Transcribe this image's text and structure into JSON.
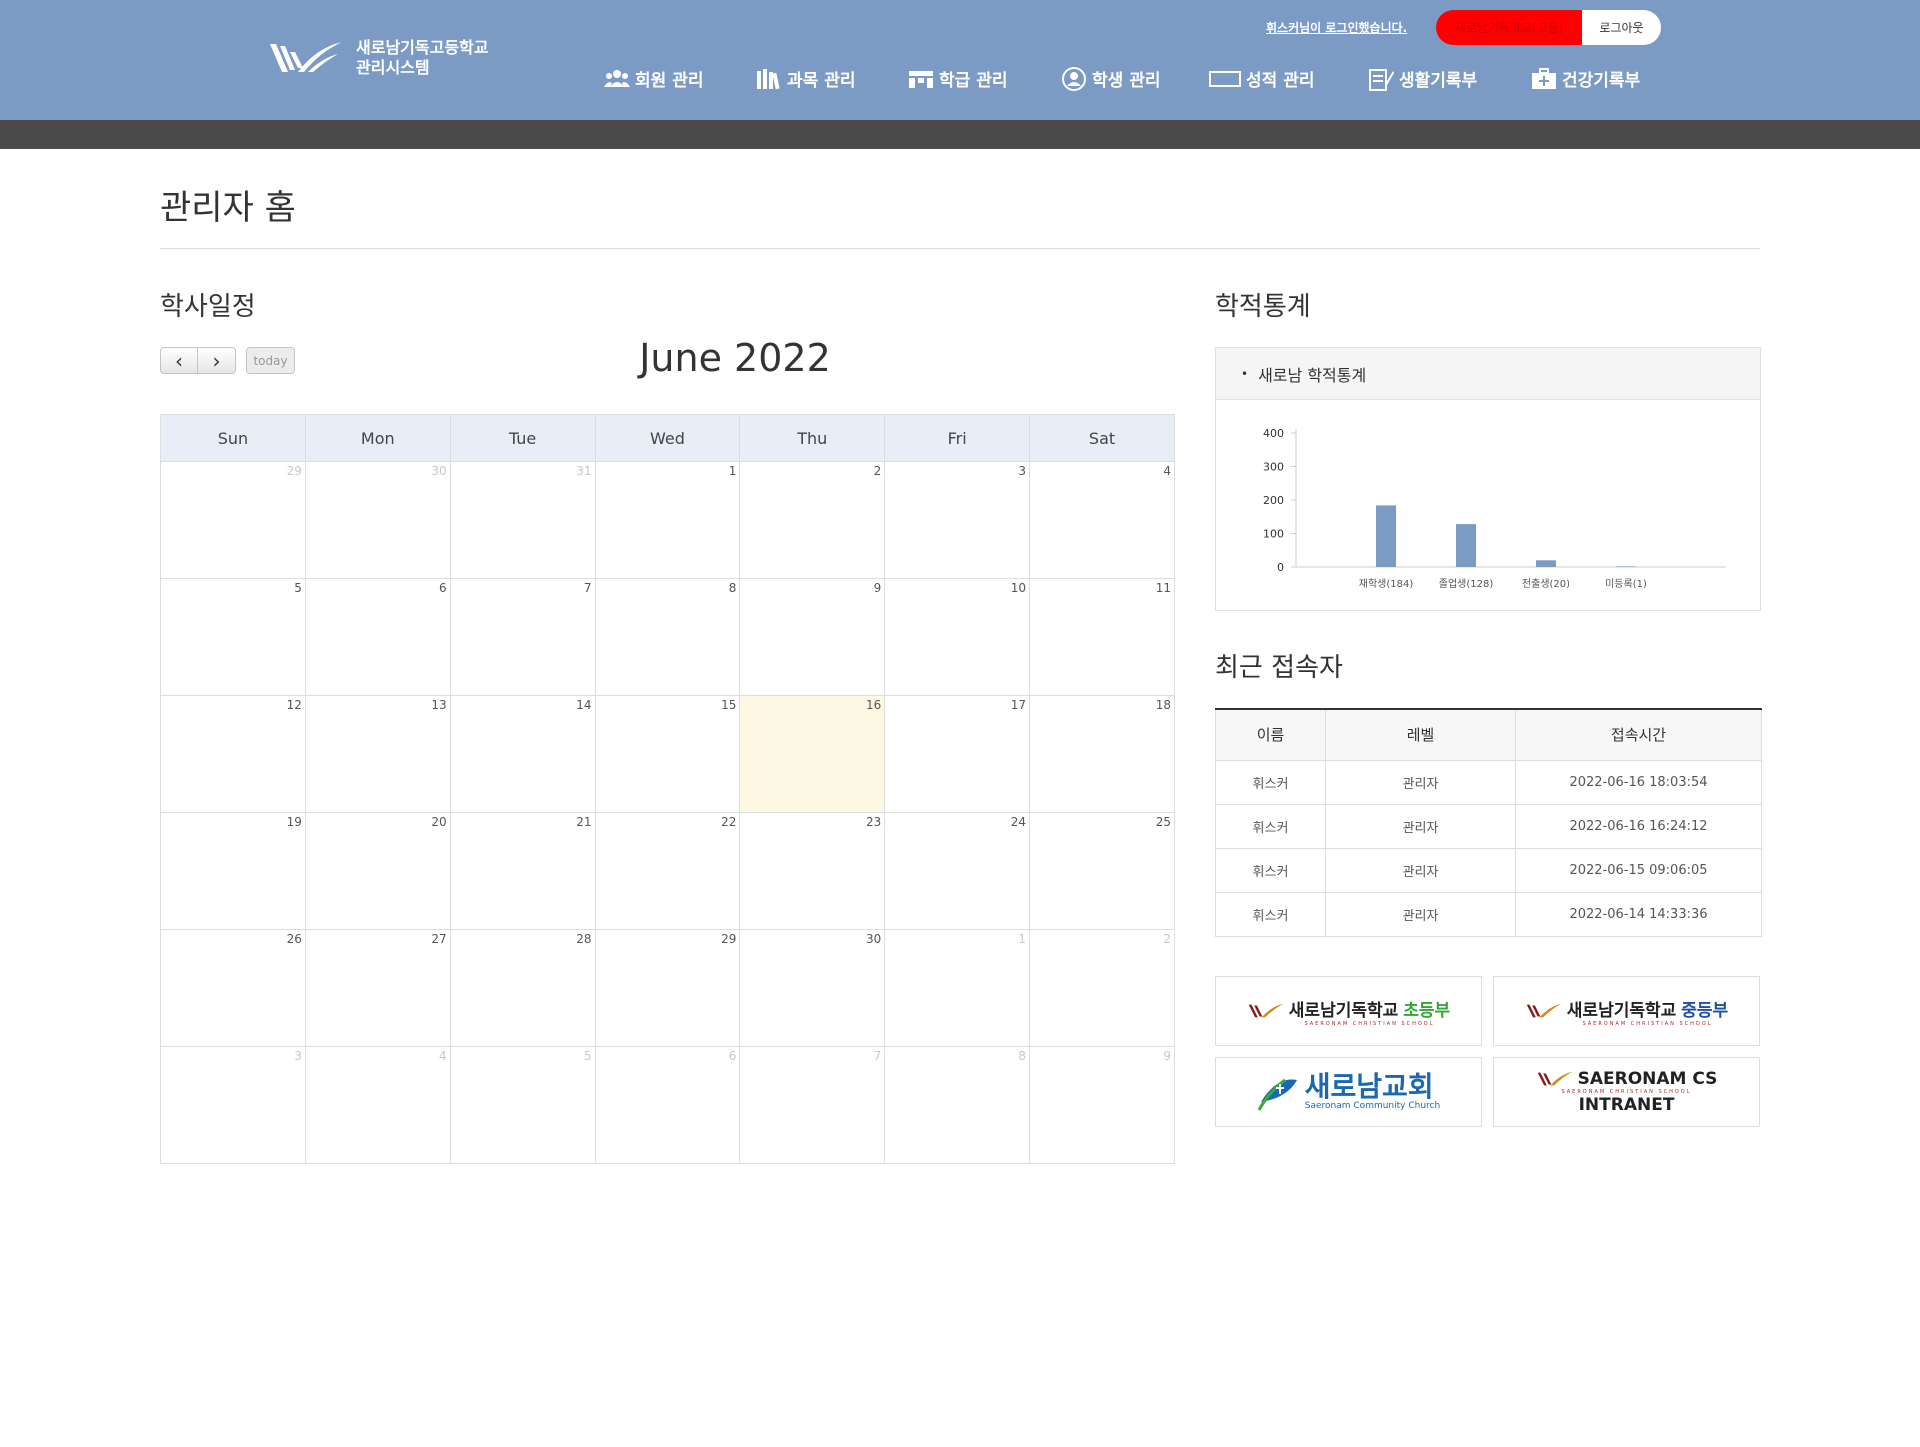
{
  "header": {
    "school_name_line1": "새로남기독고등학교",
    "school_name_line2": "관리시스템",
    "login_message": "휘스커님이 로그인했습니다.",
    "user_school_label": "새로남기독학교(고등)",
    "logout_label": "로그아웃",
    "nav": [
      {
        "label": "회원 관리",
        "icon": "users-icon"
      },
      {
        "label": "과목 관리",
        "icon": "books-icon"
      },
      {
        "label": "학급 관리",
        "icon": "classroom-icon"
      },
      {
        "label": "학생 관리",
        "icon": "student-icon"
      },
      {
        "label": "성적 관리",
        "icon": "grade-icon"
      },
      {
        "label": "생활기록부",
        "icon": "record-icon"
      },
      {
        "label": "건강기록부",
        "icon": "health-kit-icon"
      }
    ]
  },
  "page_title": "관리자 홈",
  "schedule": {
    "title": "학사일정",
    "prev_label": "‹",
    "next_label": "›",
    "today_label": "today",
    "month_title": "June 2022",
    "weekdays": [
      "Sun",
      "Mon",
      "Tue",
      "Wed",
      "Thu",
      "Fri",
      "Sat"
    ],
    "weeks": [
      [
        {
          "d": "29",
          "o": true
        },
        {
          "d": "30",
          "o": true
        },
        {
          "d": "31",
          "o": true
        },
        {
          "d": "1"
        },
        {
          "d": "2"
        },
        {
          "d": "3"
        },
        {
          "d": "4"
        }
      ],
      [
        {
          "d": "5"
        },
        {
          "d": "6"
        },
        {
          "d": "7"
        },
        {
          "d": "8"
        },
        {
          "d": "9"
        },
        {
          "d": "10"
        },
        {
          "d": "11"
        }
      ],
      [
        {
          "d": "12"
        },
        {
          "d": "13"
        },
        {
          "d": "14"
        },
        {
          "d": "15"
        },
        {
          "d": "16",
          "t": true
        },
        {
          "d": "17"
        },
        {
          "d": "18"
        }
      ],
      [
        {
          "d": "19"
        },
        {
          "d": "20"
        },
        {
          "d": "21"
        },
        {
          "d": "22"
        },
        {
          "d": "23"
        },
        {
          "d": "24"
        },
        {
          "d": "25"
        }
      ],
      [
        {
          "d": "26"
        },
        {
          "d": "27"
        },
        {
          "d": "28"
        },
        {
          "d": "29"
        },
        {
          "d": "30"
        },
        {
          "d": "1",
          "o": true
        },
        {
          "d": "2",
          "o": true
        }
      ],
      [
        {
          "d": "3",
          "o": true
        },
        {
          "d": "4",
          "o": true
        },
        {
          "d": "5",
          "o": true
        },
        {
          "d": "6",
          "o": true
        },
        {
          "d": "7",
          "o": true
        },
        {
          "d": "8",
          "o": true
        },
        {
          "d": "9",
          "o": true
        }
      ]
    ]
  },
  "stats": {
    "title": "학적통계",
    "panel_title": "새로남 학적통계"
  },
  "chart_data": {
    "type": "bar",
    "categories": [
      "재학생(184)",
      "졸업생(128)",
      "전출생(20)",
      "미등록(1)"
    ],
    "values": [
      184,
      128,
      20,
      1
    ],
    "yticks": [
      0,
      100,
      200,
      300,
      400
    ],
    "ylim": [
      0,
      400
    ],
    "bar_color": "#7c9bc4"
  },
  "visitors": {
    "title": "최근 접속자",
    "columns": [
      "이름",
      "레벨",
      "접속시간"
    ],
    "rows": [
      [
        "휘스커",
        "관리자",
        "2022-06-16 18:03:54"
      ],
      [
        "휘스커",
        "관리자",
        "2022-06-16 16:24:12"
      ],
      [
        "휘스커",
        "관리자",
        "2022-06-15 09:06:05"
      ],
      [
        "휘스커",
        "관리자",
        "2022-06-14 14:33:36"
      ]
    ]
  },
  "links": {
    "elementary_name": "새로남기독학교",
    "elementary_division": "초등부",
    "middle_name": "새로남기독학교",
    "middle_division": "중등부",
    "school_sub": "SAERONAM CHRISTIAN SCHOOL",
    "church_name": "새로남교회",
    "church_sub": "Saeronam Community Church",
    "intranet_line1": "SAERONAM CS",
    "intranet_line2": "INTRANET"
  },
  "colors": {
    "header_bg": "#7c9bc4",
    "header_strip": "#4a4a4a",
    "today_bg": "#fcf8e3",
    "pill_red": "#ff0000"
  }
}
